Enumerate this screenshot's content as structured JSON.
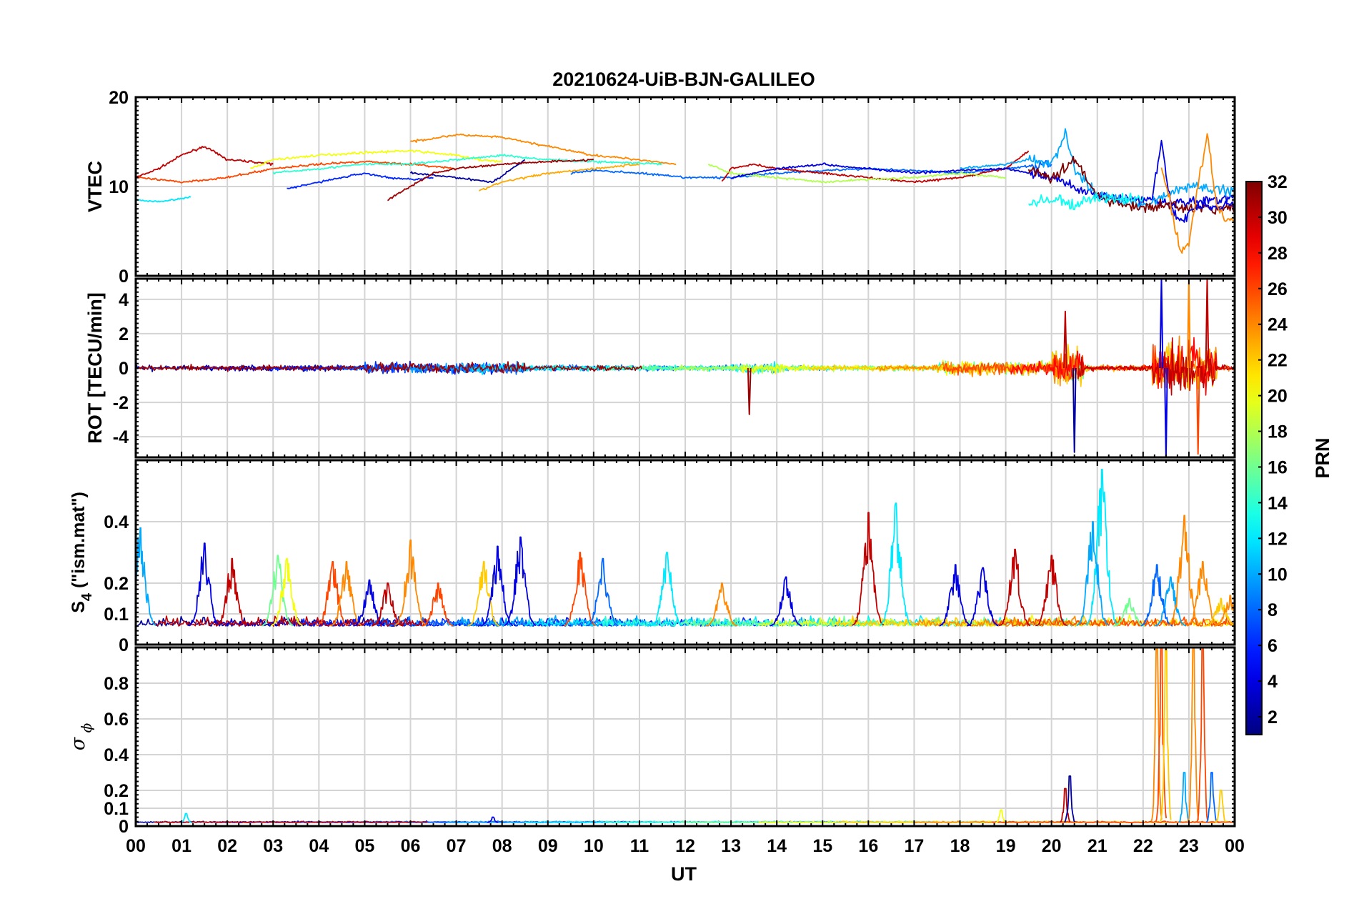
{
  "chart_data": {
    "type": "line",
    "title": "20210624-UiB-BJN-GALILEO",
    "xlabel": "UT",
    "x_tick_labels": [
      "00",
      "01",
      "02",
      "03",
      "04",
      "05",
      "06",
      "07",
      "08",
      "09",
      "10",
      "11",
      "12",
      "13",
      "14",
      "15",
      "16",
      "17",
      "18",
      "19",
      "20",
      "21",
      "22",
      "23",
      "00"
    ],
    "xlim_hours": [
      0,
      24
    ],
    "grid": true,
    "panels": [
      {
        "id": "vtec",
        "ylabel": "VTEC",
        "ylim": [
          0,
          20
        ],
        "y_ticks": [
          0,
          10,
          20
        ],
        "y_tick_labels": [
          "0",
          "10",
          "20"
        ],
        "typical_range": [
          7,
          16
        ],
        "series": [
          {
            "prn": 30,
            "x": [
              0,
              0.5,
              1,
              1.5,
              2,
              2.5,
              3
            ],
            "y": [
              11,
              12,
              13.5,
              14.5,
              13,
              12.8,
              12.5
            ]
          },
          {
            "prn": 20,
            "x": [
              2.5,
              3,
              4,
              5,
              6,
              7,
              7.5,
              8
            ],
            "y": [
              12,
              13,
              13.5,
              13.8,
              14,
              13.5,
              13,
              12.8
            ]
          },
          {
            "prn": 24,
            "x": [
              6,
              7,
              8,
              9,
              10,
              11,
              11.8
            ],
            "y": [
              15,
              15.8,
              15.5,
              14.5,
              13.5,
              13,
              12.5
            ]
          },
          {
            "prn": 26,
            "x": [
              0,
              1,
              2,
              3,
              4,
              5,
              6,
              7
            ],
            "y": [
              11,
              10.5,
              11,
              12,
              12.5,
              12.8,
              12.5,
              12
            ]
          },
          {
            "prn": 6,
            "x": [
              3.3,
              4,
              4.5,
              5,
              5.5,
              6,
              6.5
            ],
            "y": [
              9.7,
              10.5,
              11,
              11.5,
              11,
              10.8,
              11
            ]
          },
          {
            "prn": 14,
            "x": [
              3,
              4,
              5,
              6,
              7,
              8,
              9,
              10,
              11.5
            ],
            "y": [
              11.5,
              12,
              12.5,
              12.5,
              13,
              13.5,
              13,
              12.8,
              12.5
            ]
          },
          {
            "prn": 2,
            "x": [
              6,
              7,
              7.8,
              8.5
            ],
            "y": [
              11.5,
              11,
              10.5,
              13
            ]
          },
          {
            "prn": 31,
            "x": [
              5.5,
              6,
              6.5,
              7,
              8,
              9,
              10
            ],
            "y": [
              8.5,
              10,
              11.5,
              12,
              12.5,
              12.8,
              13
            ]
          },
          {
            "prn": 23,
            "x": [
              7.5,
              8,
              9,
              10,
              11
            ],
            "y": [
              9.5,
              10.5,
              11.5,
              12,
              12.5
            ]
          },
          {
            "prn": 12,
            "x": [
              0,
              0.5,
              1.2
            ],
            "y": [
              8.5,
              8.3,
              8.8
            ]
          },
          {
            "prn": 8,
            "x": [
              9.5,
              10,
              11,
              12,
              13,
              14,
              15,
              16,
              17,
              18,
              19,
              20
            ],
            "y": [
              11.5,
              11.8,
              11.5,
              11,
              11,
              11.5,
              11.8,
              12,
              11.8,
              11.5,
              12,
              12.5
            ]
          },
          {
            "prn": 30,
            "x": [
              12.8,
              13,
              13.5,
              14,
              15,
              16,
              17,
              18,
              19,
              19.5
            ],
            "y": [
              10.5,
              12,
              12.5,
              12,
              11.5,
              11,
              10.5,
              11,
              12,
              14
            ]
          },
          {
            "prn": 18,
            "x": [
              12.5,
              13,
              14,
              15,
              16,
              17,
              18,
              19
            ],
            "y": [
              12.5,
              11.5,
              11,
              10.5,
              10.8,
              11,
              11.5,
              11
            ]
          },
          {
            "prn": 4,
            "x": [
              13,
              14,
              15,
              16,
              17,
              18,
              19,
              20,
              21,
              22,
              23,
              24
            ],
            "y": [
              11,
              12,
              12.5,
              12,
              11.5,
              11.8,
              12,
              11,
              9,
              8.5,
              8.2,
              8.8
            ]
          },
          {
            "prn": 10,
            "x": [
              18,
              19,
              19.5,
              20,
              20.3,
              20.5,
              21,
              22,
              22.5,
              23,
              24
            ],
            "y": [
              12,
              12.5,
              13,
              12.5,
              16,
              12,
              9,
              8,
              9,
              10,
              9.5
            ]
          },
          {
            "prn": 32,
            "x": [
              19.5,
              20,
              20.5,
              21,
              21.5,
              22,
              22.5,
              23,
              24
            ],
            "y": [
              12,
              11,
              13,
              9,
              8,
              7.5,
              8,
              7.5,
              7.5
            ]
          },
          {
            "prn": 4,
            "x": [
              22.2,
              22.4,
              22.6,
              22.8,
              23,
              23.3,
              23.6,
              24
            ],
            "y": [
              9,
              15,
              8,
              6,
              7,
              8,
              7.5,
              8
            ]
          },
          {
            "prn": 24,
            "x": [
              22.4,
              22.6,
              22.8,
              23,
              23.2,
              23.4,
              23.6,
              23.8,
              24
            ],
            "y": [
              12,
              8,
              3,
              3.5,
              10,
              16,
              8,
              6.5,
              6
            ]
          },
          {
            "prn": 13,
            "x": [
              19.5,
              20,
              20.5,
              21,
              21.5,
              22
            ],
            "y": [
              8,
              8.5,
              8,
              8.8,
              8.5,
              8.8
            ]
          }
        ]
      },
      {
        "id": "rot",
        "ylabel": "ROT [TECU/min]",
        "ylim": [
          -5.2,
          5.2
        ],
        "y_ticks": [
          -4,
          -2,
          0,
          2,
          4
        ],
        "y_tick_labels": [
          "-4",
          "-2",
          "0",
          "2",
          "4"
        ],
        "typical_range": [
          -1,
          1
        ],
        "bursts_hours": [
          [
            13.0,
            14.2
          ],
          [
            20.0,
            20.7
          ],
          [
            22.2,
            23.6
          ]
        ],
        "burst_peaks": [
          {
            "x": 13.4,
            "y": -2.7
          },
          {
            "x": 20.3,
            "y": 3.3
          },
          {
            "x": 20.5,
            "y": -4.9
          },
          {
            "x": 22.4,
            "y": 5.2
          },
          {
            "x": 22.5,
            "y": -5.2
          },
          {
            "x": 23.0,
            "y": 5.2
          },
          {
            "x": 23.2,
            "y": -5.0
          },
          {
            "x": 23.4,
            "y": 5.2
          }
        ]
      },
      {
        "id": "s4",
        "ylabel_main": "S",
        "ylabel_sub": "4",
        "ylabel_rest": " (\"ism.mat\")",
        "ylim": [
          0,
          0.6
        ],
        "y_ticks": [
          0,
          0.1,
          0.2,
          0.4
        ],
        "y_tick_labels": [
          "0",
          "0.1",
          "0.2",
          "0.4"
        ],
        "baseline": 0.06,
        "peaks": [
          {
            "x": 0.1,
            "y": 0.38,
            "prn": 10
          },
          {
            "x": 1.5,
            "y": 0.33,
            "prn": 4
          },
          {
            "x": 2.1,
            "y": 0.28,
            "prn": 30
          },
          {
            "x": 3.1,
            "y": 0.29,
            "prn": 16
          },
          {
            "x": 3.3,
            "y": 0.28,
            "prn": 20
          },
          {
            "x": 4.3,
            "y": 0.27,
            "prn": 26
          },
          {
            "x": 4.6,
            "y": 0.27,
            "prn": 24
          },
          {
            "x": 5.1,
            "y": 0.21,
            "prn": 4
          },
          {
            "x": 5.5,
            "y": 0.2,
            "prn": 30
          },
          {
            "x": 6.0,
            "y": 0.34,
            "prn": 24
          },
          {
            "x": 6.6,
            "y": 0.2,
            "prn": 26
          },
          {
            "x": 7.6,
            "y": 0.27,
            "prn": 22
          },
          {
            "x": 7.9,
            "y": 0.32,
            "prn": 4
          },
          {
            "x": 8.4,
            "y": 0.35,
            "prn": 4
          },
          {
            "x": 9.7,
            "y": 0.3,
            "prn": 26
          },
          {
            "x": 10.2,
            "y": 0.28,
            "prn": 8
          },
          {
            "x": 11.6,
            "y": 0.3,
            "prn": 12
          },
          {
            "x": 12.8,
            "y": 0.2,
            "prn": 24
          },
          {
            "x": 14.2,
            "y": 0.22,
            "prn": 4
          },
          {
            "x": 16.0,
            "y": 0.43,
            "prn": 30
          },
          {
            "x": 16.6,
            "y": 0.46,
            "prn": 12
          },
          {
            "x": 17.9,
            "y": 0.26,
            "prn": 4
          },
          {
            "x": 18.5,
            "y": 0.25,
            "prn": 4
          },
          {
            "x": 19.2,
            "y": 0.31,
            "prn": 30
          },
          {
            "x": 20.0,
            "y": 0.29,
            "prn": 30
          },
          {
            "x": 21.1,
            "y": 0.57,
            "prn": 12
          },
          {
            "x": 20.9,
            "y": 0.4,
            "prn": 10
          },
          {
            "x": 21.7,
            "y": 0.15,
            "prn": 16
          },
          {
            "x": 22.3,
            "y": 0.26,
            "prn": 8
          },
          {
            "x": 22.6,
            "y": 0.22,
            "prn": 10
          },
          {
            "x": 22.9,
            "y": 0.42,
            "prn": 24
          },
          {
            "x": 23.3,
            "y": 0.27,
            "prn": 24
          },
          {
            "x": 23.7,
            "y": 0.15,
            "prn": 22
          },
          {
            "x": 23.9,
            "y": 0.16,
            "prn": 24
          }
        ]
      },
      {
        "id": "sigma_phi",
        "ylabel": "σ",
        "ylabel_sub": "ϕ",
        "ylim": [
          0,
          1.0
        ],
        "y_ticks": [
          0,
          0.1,
          0.2,
          0.4,
          0.6,
          0.8
        ],
        "y_tick_labels": [
          "0",
          "0.1",
          "0.2",
          "0.4",
          "0.6",
          "0.8"
        ],
        "baseline": 0.02,
        "peaks": [
          {
            "x": 1.1,
            "y": 0.07,
            "prn": 12
          },
          {
            "x": 7.8,
            "y": 0.05,
            "prn": 4
          },
          {
            "x": 18.9,
            "y": 0.09,
            "prn": 20
          },
          {
            "x": 20.3,
            "y": 0.21,
            "prn": 30
          },
          {
            "x": 20.4,
            "y": 0.28,
            "prn": 2
          },
          {
            "x": 22.3,
            "y": 1.0,
            "prn": 24
          },
          {
            "x": 22.4,
            "y": 1.0,
            "prn": 26
          },
          {
            "x": 22.5,
            "y": 1.0,
            "prn": 22
          },
          {
            "x": 22.9,
            "y": 0.3,
            "prn": 10
          },
          {
            "x": 23.1,
            "y": 1.0,
            "prn": 24
          },
          {
            "x": 23.3,
            "y": 1.0,
            "prn": 26
          },
          {
            "x": 23.5,
            "y": 0.3,
            "prn": 8
          },
          {
            "x": 23.7,
            "y": 0.2,
            "prn": 22
          }
        ]
      }
    ],
    "colorbar": {
      "label": "PRN",
      "range": [
        1,
        32
      ],
      "ticks": [
        2,
        4,
        6,
        8,
        10,
        12,
        14,
        16,
        18,
        20,
        22,
        24,
        26,
        28,
        30,
        32
      ],
      "tick_labels": [
        "2",
        "4",
        "6",
        "8",
        "10",
        "12",
        "14",
        "16",
        "18",
        "20",
        "22",
        "24",
        "26",
        "28",
        "30",
        "32"
      ],
      "colormap": "jet"
    }
  }
}
